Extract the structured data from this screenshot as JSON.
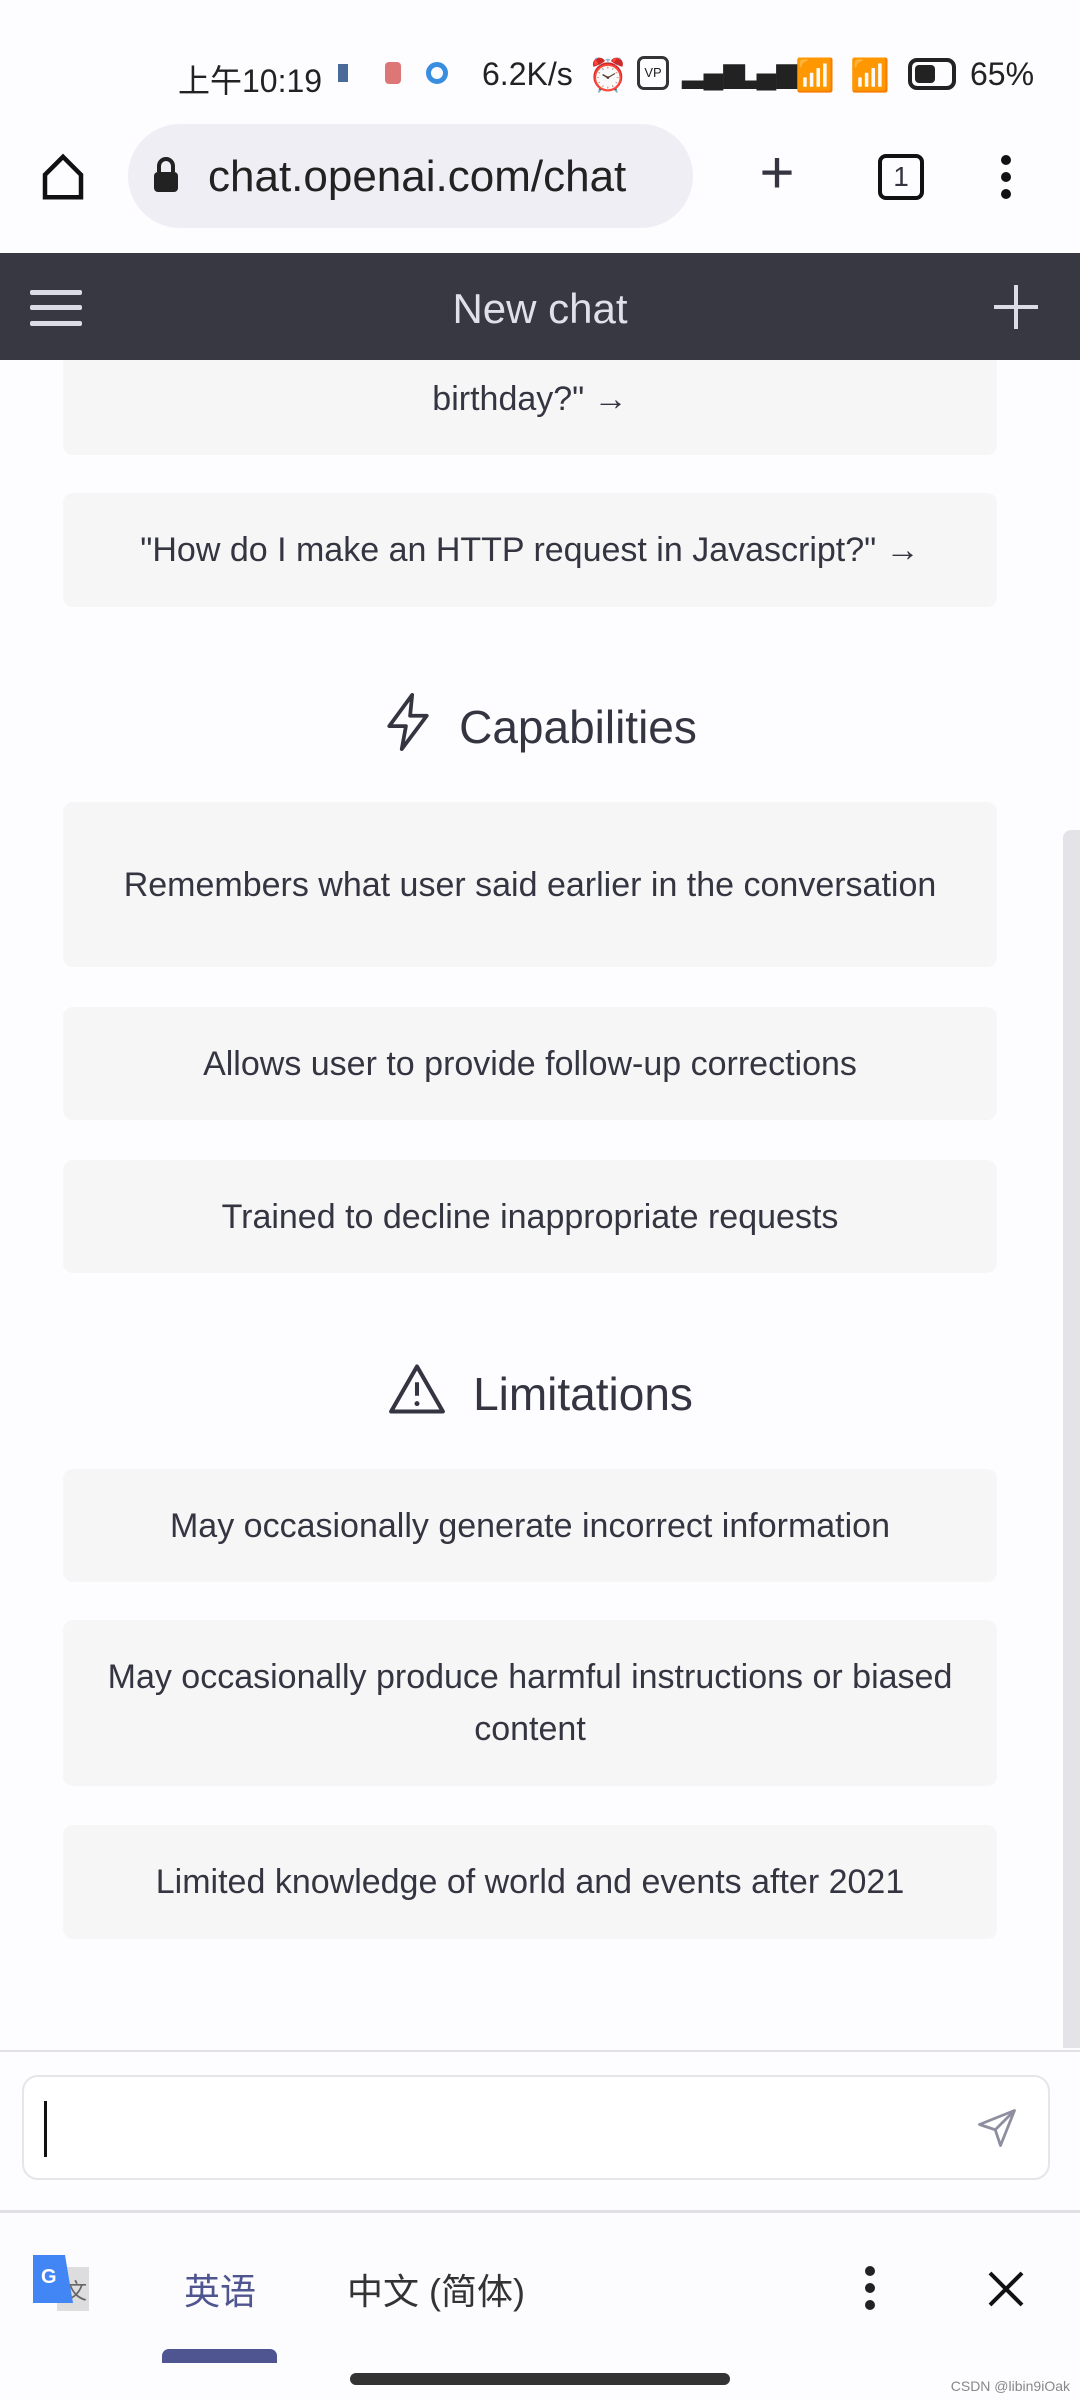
{
  "status_bar": {
    "time": "上午10:19",
    "net_speed": "6.2K/s",
    "battery": "65%"
  },
  "browser": {
    "url": "chat.openai.com/chat",
    "tab_count": "1"
  },
  "header": {
    "title": "New chat"
  },
  "examples": [
    "birthday?\" →",
    "\"How do I make an HTTP request in Javascript?\" →"
  ],
  "capabilities": {
    "title": "Capabilities",
    "items": [
      "Remembers what user said earlier in the conversation",
      "Allows user to provide follow-up corrections",
      "Trained to decline inappropriate requests"
    ]
  },
  "limitations": {
    "title": "Limitations",
    "items": [
      "May occasionally generate incorrect information",
      "May occasionally produce harmful instructions or biased content",
      "Limited knowledge of world and events after 2021"
    ]
  },
  "input": {
    "value": ""
  },
  "translate_bar": {
    "source_lang": "英语",
    "target_lang": "中文 (简体)",
    "accent": "#4f5590"
  },
  "watermark": "CSDN @libin9iOak"
}
